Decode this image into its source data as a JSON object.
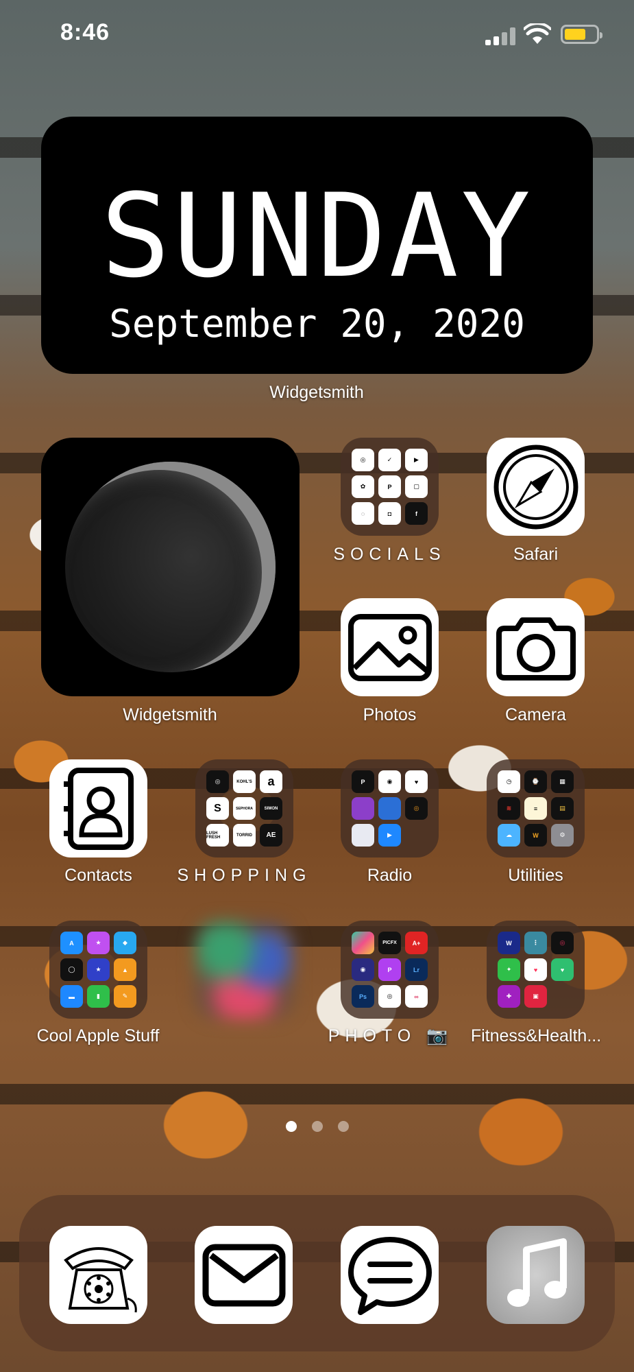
{
  "status_bar": {
    "time": "8:46"
  },
  "date_widget": {
    "day": "SUNDAY",
    "date": "September 20, 2020",
    "label": "Widgetsmith"
  },
  "moon_widget": {
    "label": "Widgetsmith"
  },
  "apps": {
    "socials": "SOCIALS",
    "safari": "Safari",
    "photos": "Photos",
    "camera": "Camera",
    "contacts": "Contacts",
    "shopping": "SHOPPING",
    "radio": "Radio",
    "utilities": "Utilities",
    "cool_apple_stuff": "Cool Apple Stuff",
    "photo_folder": "PHOTO 📷",
    "fitness": "Fitness&Health..."
  },
  "shopping_minis": [
    "KOHL'S",
    "a",
    "S",
    "SEPHORA",
    "SIMON",
    "LUSH FRESH",
    "TORRID",
    "AE"
  ],
  "page_dots": {
    "count": 3,
    "active": 0
  },
  "dock": [
    "phone",
    "mail",
    "messages",
    "music"
  ]
}
